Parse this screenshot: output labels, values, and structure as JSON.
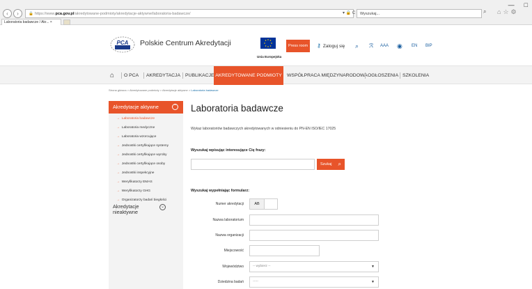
{
  "browser": {
    "url_prefix": "https://www.",
    "url_domain": "pca.gov.pl",
    "url_path": "/akredytowane-podmioty/akredytacje-aktywne/laboratoria-badawcze/",
    "url_controls": "▾ 🔒 C",
    "search_placeholder": "Wyszukaj...",
    "tab_title": "Laboratoria badawcze / Akr...",
    "window_controls": [
      "—",
      "□"
    ]
  },
  "header": {
    "site_name": "Polskie Centrum Akredytacji",
    "logo_text": "PCA",
    "eu_label": "Unia Europejska",
    "press_room": "Press room",
    "login": "Zaloguj się",
    "font_size_label": "AAA",
    "lang_en": "EN",
    "bip": "BIP",
    "icons": [
      "search-icon",
      "rss-icon",
      "contrast-icon"
    ]
  },
  "nav": {
    "home_icon": "home-icon",
    "items": [
      "O PCA",
      "AKREDYTACJA",
      "PUBLIKACJE",
      "AKREDYTOWANE PODMIOTY",
      "WSPÓŁPRACA MIĘDZYNARODOWA",
      "OGŁOSZENIA",
      "SZKOLENIA"
    ],
    "active": "AKREDYTOWANE PODMIOTY"
  },
  "breadcrumb": {
    "items": [
      "Strona główna",
      "Akredytowane podmioty",
      "Akredytacje aktywne"
    ],
    "current": "Laboratoria badawcze",
    "separator": ">"
  },
  "sidebar": {
    "active_title": "Akredytacje aktywne",
    "items": [
      "Laboratoria badawcze",
      "Laboratoria medyczne",
      "Laboratoria wzorcujące",
      "Jednostki certyfikujące systemy",
      "Jednostki certyfikujące wyroby",
      "Jednostki certyfikujące osoby",
      "Jednostki inspekcyjne",
      "Weryfikatorzy EMAS",
      "Weryfikatorzy GHG",
      "Organizatorzy badań biegłości"
    ],
    "active_item": "Laboratoria badawcze",
    "inactive_title": "Akredytacje nieaktywne"
  },
  "content": {
    "title": "Laboratoria badawcze",
    "description": "Wykaz laboratoriów badawczych akredytowanych w odniesieniu do PN-EN ISO/IEC 17025",
    "phrase_search_label": "Wyszukaj wpisując interesujące Cię frazy:",
    "search_button": "Szukaj",
    "form_label": "Wyszukaj wypełniając formularz:",
    "fields": {
      "accreditation_number": "Numer akredytacji",
      "accreditation_prefix": "AB",
      "lab_name": "Nazwa laboratorium",
      "org_name": "Nazwa organizacji",
      "city": "Miejscowość",
      "voivodeship": "Województwo",
      "voivodeship_value": "-- wybierz --",
      "field_of_testing": "Dziedzina badań",
      "field_of_testing_value": "-----"
    }
  },
  "colors": {
    "accent": "#e8542a",
    "link": "#1a6fa8",
    "eu_blue": "#003399"
  }
}
